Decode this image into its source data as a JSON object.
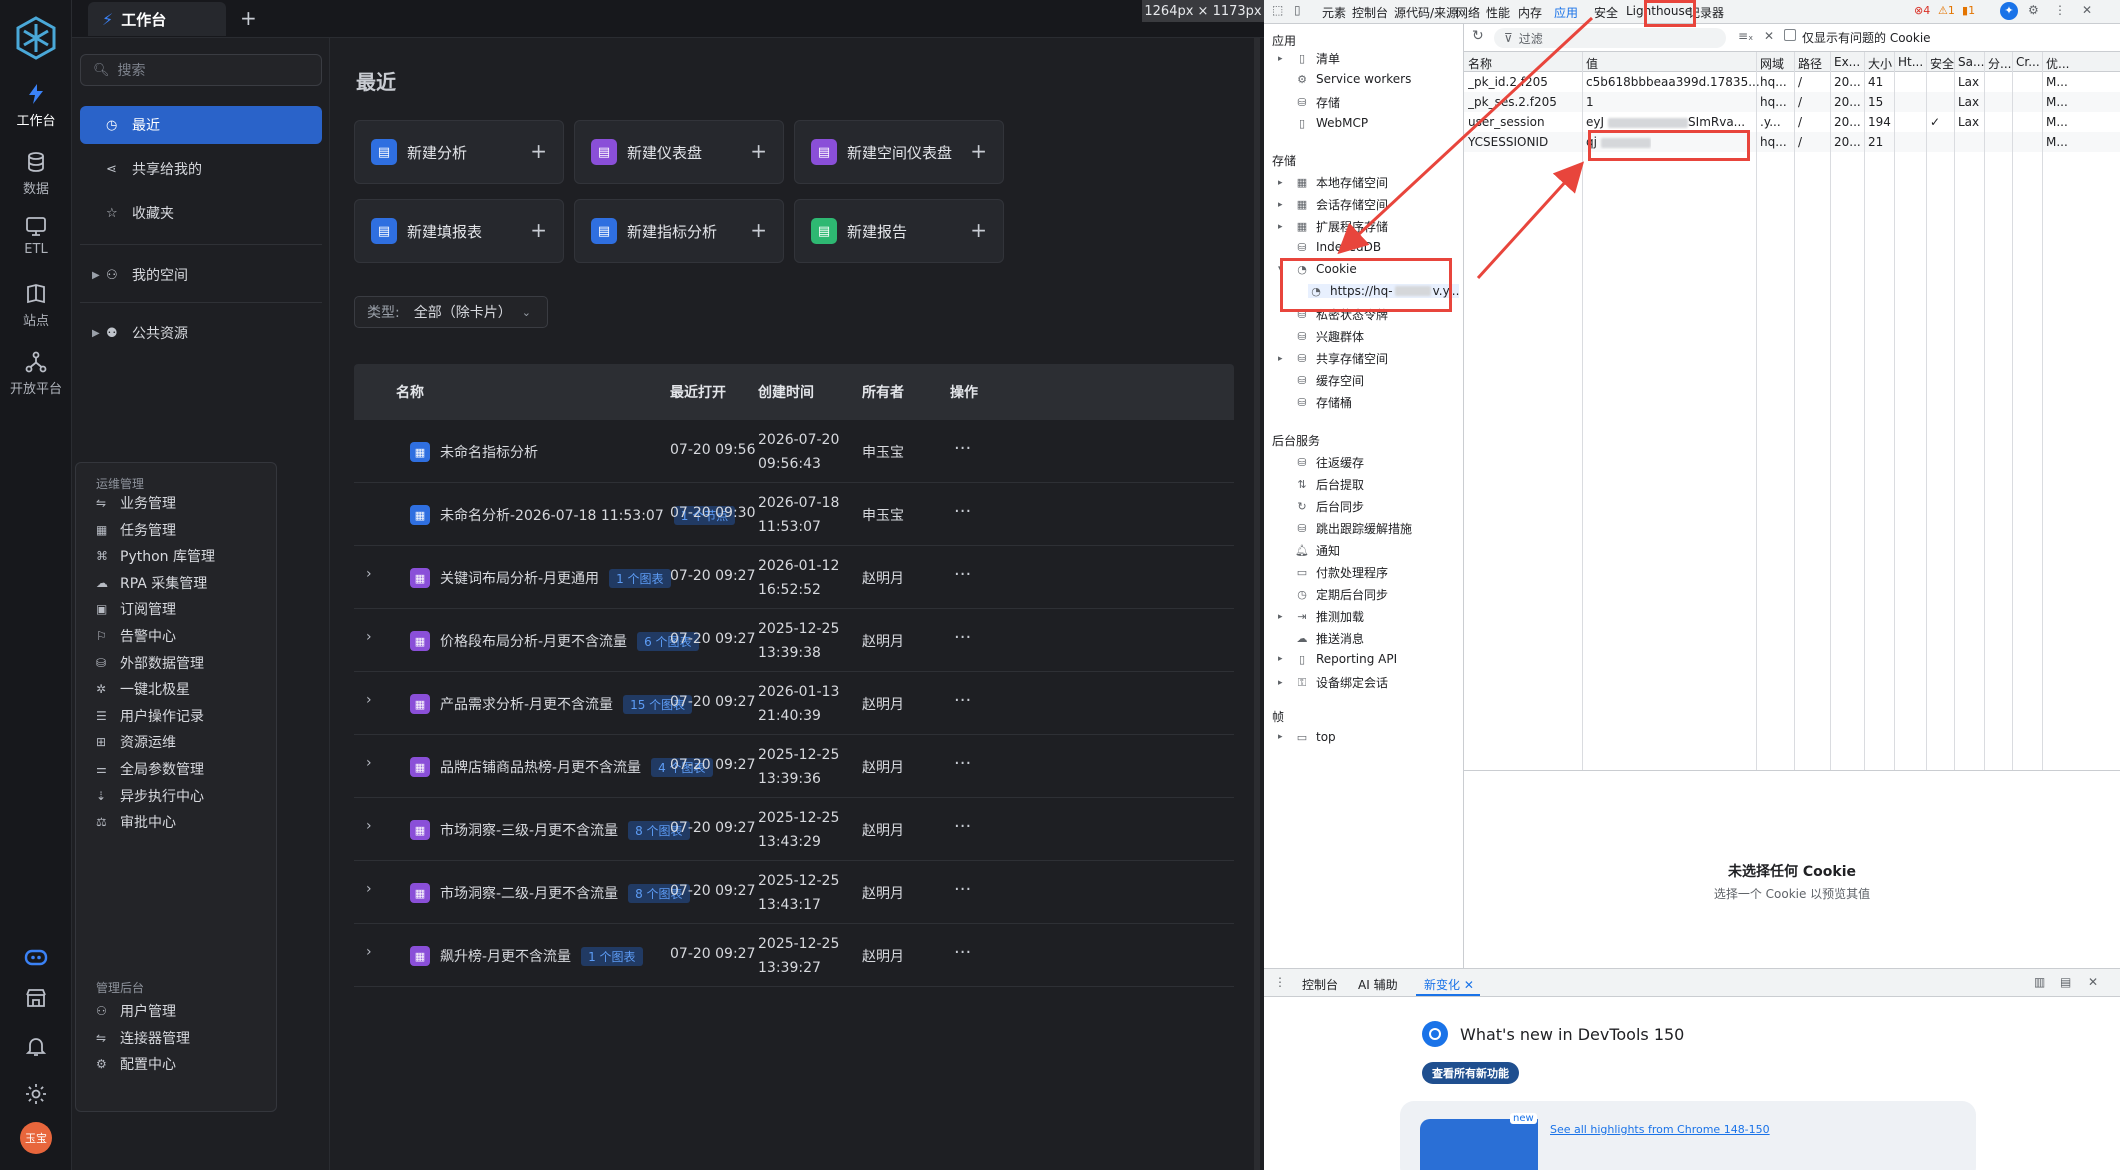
{
  "rail": {
    "items": [
      {
        "label": "工作台",
        "icon": "workbench-icon"
      },
      {
        "label": "数据",
        "icon": "database-icon"
      },
      {
        "label": "ETL",
        "icon": "etl-icon"
      },
      {
        "label": "站点",
        "icon": "site-icon"
      },
      {
        "label": "开放平台",
        "icon": "open-platform-icon"
      }
    ],
    "avatar_text": "玉宝"
  },
  "tabbar": {
    "tab_label": "工作台",
    "add_label": "+",
    "dimension_label": "1264px × 1173px"
  },
  "nav": {
    "search_placeholder": "搜索",
    "items": [
      {
        "label": "最近"
      },
      {
        "label": "共享给我的"
      },
      {
        "label": "收藏夹"
      },
      {
        "label": "我的空间"
      },
      {
        "label": "公共资源"
      }
    ]
  },
  "menu": {
    "section1": "运维管理",
    "ops": [
      "业务管理",
      "任务管理",
      "Python 库管理",
      "RPA 采集管理",
      "订阅管理",
      "告警中心",
      "外部数据管理",
      "一键北极星",
      "用户操作记录",
      "资源运维",
      "全局参数管理",
      "异步执行中心",
      "审批中心"
    ],
    "section2": "管理后台",
    "admin": [
      "用户管理",
      "连接器管理",
      "配置中心"
    ]
  },
  "main": {
    "heading": "最近",
    "quick": [
      {
        "label": "新建分析",
        "color": "#2f6fe0"
      },
      {
        "label": "新建仪表盘",
        "color": "#8a4fd8"
      },
      {
        "label": "新建空间仪表盘",
        "color": "#8a4fd8"
      },
      {
        "label": "新建填报表",
        "color": "#2f6fe0"
      },
      {
        "label": "新建指标分析",
        "color": "#2f6fe0"
      },
      {
        "label": "新建报告",
        "color": "#2eb872"
      }
    ],
    "plus": "+",
    "filter": {
      "label": "类型:",
      "value": "全部（除卡片）"
    },
    "columns": [
      "名称",
      "最近打开",
      "创建时间",
      "所有者",
      "操作"
    ],
    "rows": [
      {
        "name": "未命名指标分析",
        "badge": "",
        "opened": "07-20 09:56",
        "created_date": "2026-07-20",
        "created_time": "09:56:43",
        "owner": "申玉宝",
        "expandable": false,
        "color": "#2f6fe0"
      },
      {
        "name": "未命名分析-2026-07-18 11:53:07",
        "badge": "1 个节点",
        "opened": "07-20 09:30",
        "created_date": "2026-07-18",
        "created_time": "11:53:07",
        "owner": "申玉宝",
        "expandable": false,
        "color": "#2f6fe0"
      },
      {
        "name": "关键词布局分析-月更通用",
        "badge": "1 个图表",
        "opened": "07-20 09:27",
        "created_date": "2026-01-12",
        "created_time": "16:52:52",
        "owner": "赵明月",
        "expandable": true,
        "color": "#8a4fd8"
      },
      {
        "name": "价格段布局分析-月更不含流量",
        "badge": "6 个图表",
        "opened": "07-20 09:27",
        "created_date": "2025-12-25",
        "created_time": "13:39:38",
        "owner": "赵明月",
        "expandable": true,
        "color": "#8a4fd8"
      },
      {
        "name": "产品需求分析-月更不含流量",
        "badge": "15 个图表",
        "opened": "07-20 09:27",
        "created_date": "2026-01-13",
        "created_time": "21:40:39",
        "owner": "赵明月",
        "expandable": true,
        "color": "#8a4fd8"
      },
      {
        "name": "品牌店铺商品热榜-月更不含流量",
        "badge": "4 个图表",
        "opened": "07-20 09:27",
        "created_date": "2025-12-25",
        "created_time": "13:39:36",
        "owner": "赵明月",
        "expandable": true,
        "color": "#8a4fd8"
      },
      {
        "name": "市场洞察-三级-月更不含流量",
        "badge": "8 个图表",
        "opened": "07-20 09:27",
        "created_date": "2025-12-25",
        "created_time": "13:43:29",
        "owner": "赵明月",
        "expandable": true,
        "color": "#8a4fd8"
      },
      {
        "name": "市场洞察-二级-月更不含流量",
        "badge": "8 个图表",
        "opened": "07-20 09:27",
        "created_date": "2025-12-25",
        "created_time": "13:43:17",
        "owner": "赵明月",
        "expandable": true,
        "color": "#8a4fd8"
      },
      {
        "name": "飙升榜-月更不含流量",
        "badge": "1 个图表",
        "opened": "07-20 09:27",
        "created_date": "2025-12-25",
        "created_time": "13:39:27",
        "owner": "赵明月",
        "expandable": true,
        "color": "#8a4fd8"
      }
    ],
    "more": "···"
  },
  "devtools": {
    "tabs": [
      "元素",
      "控制台",
      "源代码/来源",
      "网络",
      "性能",
      "内存",
      "应用",
      "安全",
      "Lighthouse",
      "记录器"
    ],
    "active_tab": "应用",
    "errors": "4",
    "warnings": "1",
    "info": "1",
    "tree": {
      "app_section": "应用",
      "app_items": [
        "清单",
        "Service workers",
        "存储",
        "WebMCP"
      ],
      "storage_section": "存储",
      "storage_items": [
        "本地存储空间",
        "会话存储空间",
        "扩展程序存储",
        "IndexedDB",
        "Cookie",
        "私密状态令牌",
        "兴趣群体",
        "共享存储空间",
        "缓存空间",
        "存储桶"
      ],
      "cookie_child": "https://hq-",
      "cookie_child_tail": "v.y...",
      "bg_section": "后台服务",
      "bg_items": [
        "往返缓存",
        "后台提取",
        "后台同步",
        "跳出跟踪缓解措施",
        "通知",
        "付款处理程序",
        "定期后台同步",
        "推测加载",
        "推送消息",
        "Reporting API",
        "设备绑定会话"
      ],
      "frames_section": "帧",
      "frames_items": [
        "top"
      ]
    },
    "filter_placeholder": "过滤",
    "only_issue_label": "仅显示有问题的 Cookie",
    "columns": [
      "名称",
      "值",
      "网域",
      "路径",
      "Ex...",
      "大小",
      "Ht...",
      "安全",
      "Sa...",
      "分...",
      "Cr...",
      "优..."
    ],
    "cookies": [
      {
        "name": "_pk_id.2.f205",
        "value": "c5b618bbbeaa399d.17835...",
        "domain": "hq...",
        "path": "/",
        "expires": "20...",
        "size": "41",
        "secure": "",
        "samesite": "Lax",
        "priority": "M..."
      },
      {
        "name": "_pk_ses.2.f205",
        "value": "1",
        "domain": "hq...",
        "path": "/",
        "expires": "20...",
        "size": "15",
        "secure": "",
        "samesite": "Lax",
        "priority": "M..."
      },
      {
        "name": "user_session",
        "value": "eyJ",
        "value_tail": "SImRva...",
        "domain": ".y...",
        "path": "/",
        "expires": "20...",
        "size": "194",
        "secure": "✓",
        "samesite": "Lax",
        "priority": "M..."
      },
      {
        "name": "YCSESSIONID",
        "value": "qj",
        "domain": "hq...",
        "path": "/",
        "expires": "20...",
        "size": "21",
        "secure": "",
        "samesite": "",
        "priority": "M..."
      }
    ],
    "no_cookie_title": "未选择任何 Cookie",
    "no_cookie_sub": "选择一个 Cookie 以预览其值",
    "drawer_tabs": [
      "控制台",
      "AI 辅助",
      "新变化"
    ],
    "whats_new": "What's new in DevTools 150",
    "see_all": "查看所有新功能",
    "new_badge": "new",
    "highlights": "See all highlights from Chrome 148-150"
  }
}
